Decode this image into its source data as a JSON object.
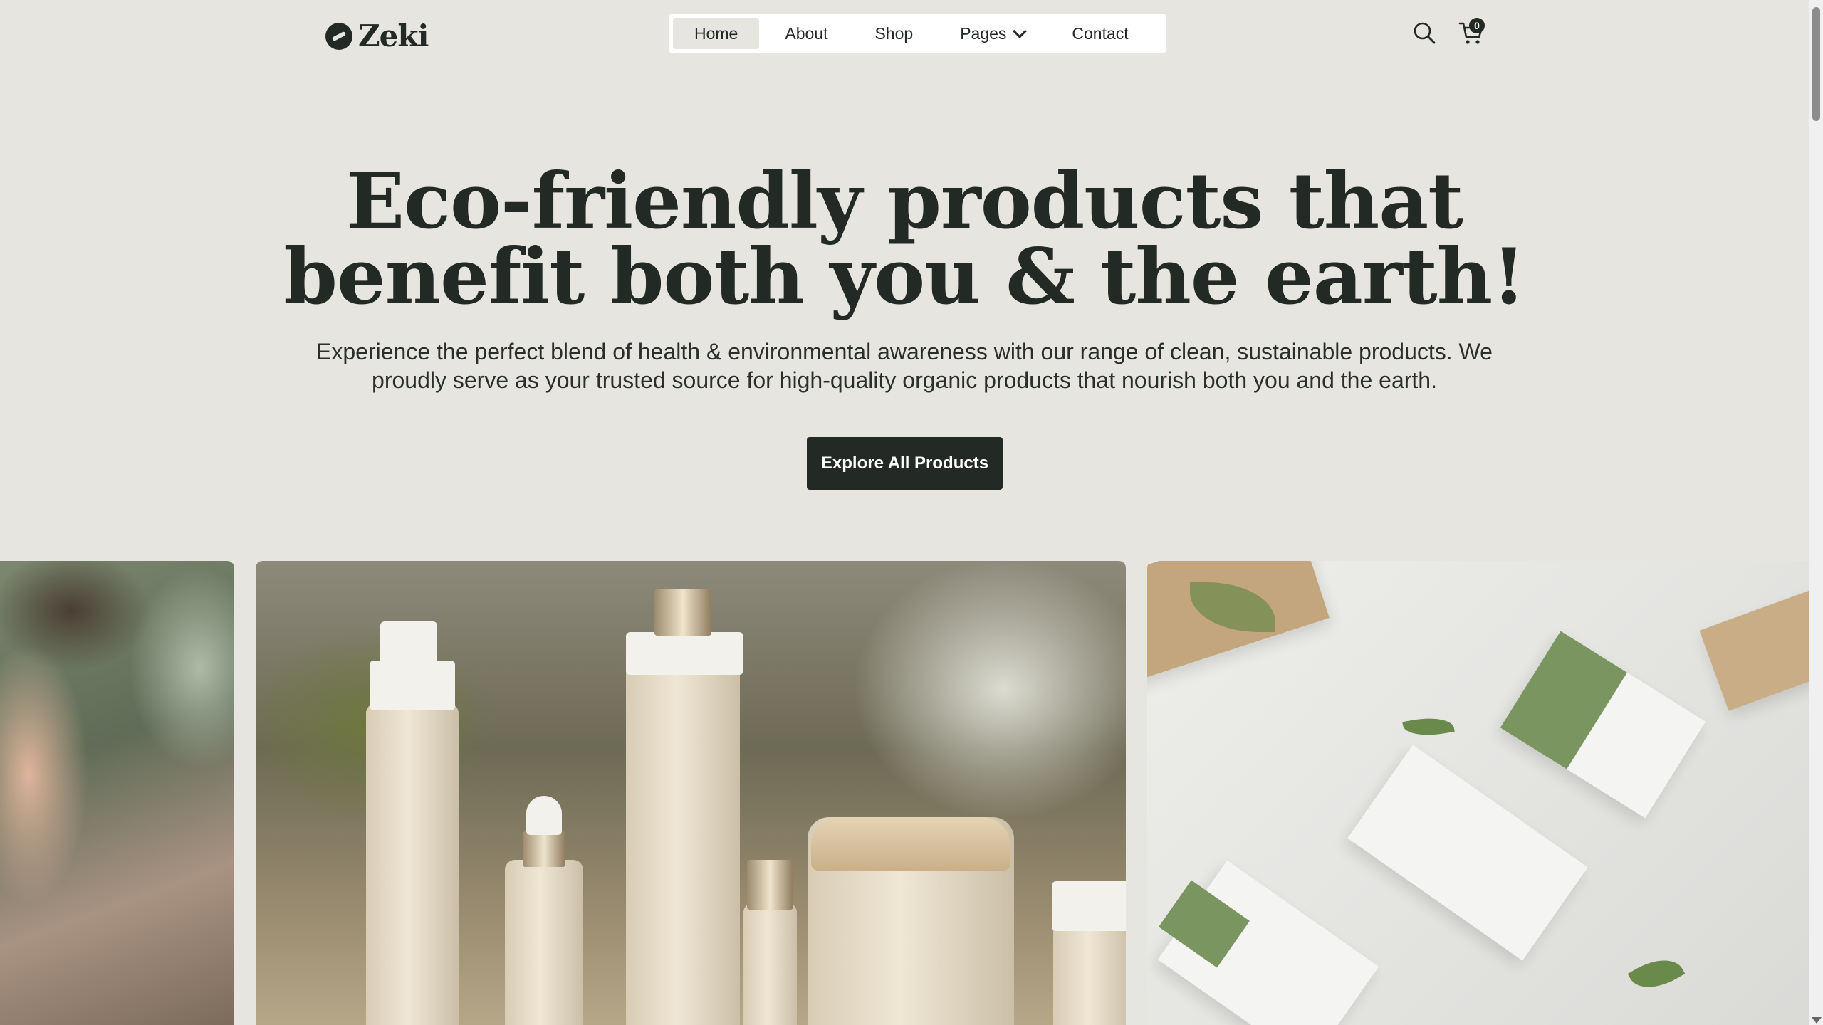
{
  "brand": {
    "name": "Zeki"
  },
  "nav": {
    "items": [
      {
        "label": "Home"
      },
      {
        "label": "About"
      },
      {
        "label": "Shop"
      },
      {
        "label": "Pages"
      },
      {
        "label": "Contact"
      }
    ]
  },
  "header": {
    "cart_count": "0"
  },
  "hero": {
    "title_line1": "Eco-friendly products that",
    "title_line2": "benefit both you & the earth!",
    "subtitle_line1": "Experience the perfect blend of health & environmental awareness with our range of clean, sustainable products. We",
    "subtitle_line2": "proudly serve as your trusted source for high-quality organic products that nourish both you and the earth.",
    "cta_label": "Explore All Products"
  },
  "icons": {
    "logo": "logo-icon",
    "search": "search-icon",
    "cart": "cart-icon",
    "pages_dropdown": "chevron-down-icon"
  },
  "colors": {
    "background": "#e6e5e0",
    "primary_dark": "#232925",
    "nav_background": "#ffffff"
  }
}
